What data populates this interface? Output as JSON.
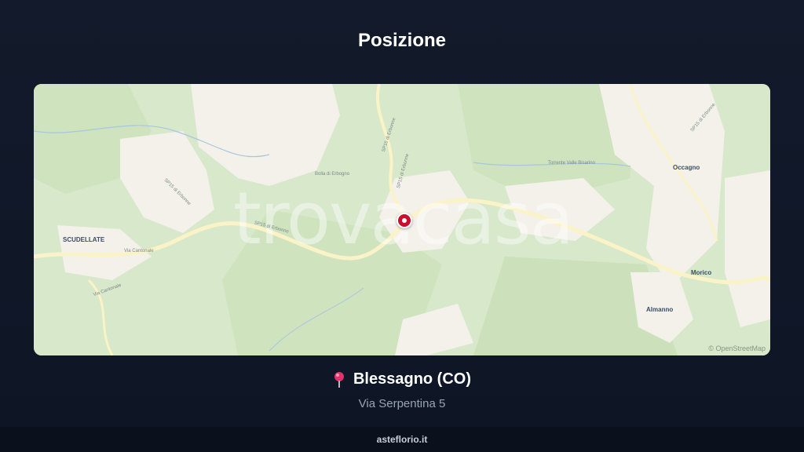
{
  "header": {
    "title": "Posizione"
  },
  "map": {
    "watermark": "trovacasa",
    "attribution": "© OpenStreetMap",
    "places": {
      "occagno": "Occagno",
      "scudellate": "SCUDELLATE",
      "morico": "Morico",
      "almanno": "Almanno"
    },
    "roads": {
      "road_1": "SP15 di Erbonne",
      "road_2": "SP15 di Erbonne",
      "road_3": "SP15 di Erbonne",
      "road_4": "SP15 di Erbonne",
      "road_5": "Via Cantonale",
      "road_6": "Via Cantonale",
      "road_7": "SP15 di Erbonne",
      "road_8": "Torrente Valle Bisarino",
      "road_9": "Bolla di Erbogno"
    },
    "marker_icon": "location-marker-icon"
  },
  "location": {
    "pin_icon": "map-pin-icon",
    "city": "Blessagno (CO)",
    "address": "Via Serpentina 5"
  },
  "footer": {
    "site": "asteflorio.it"
  },
  "colors": {
    "background": "#121a2b",
    "map_forest": "#cfe3bf",
    "map_open": "#f3f1ea",
    "marker": "#c8102e"
  }
}
